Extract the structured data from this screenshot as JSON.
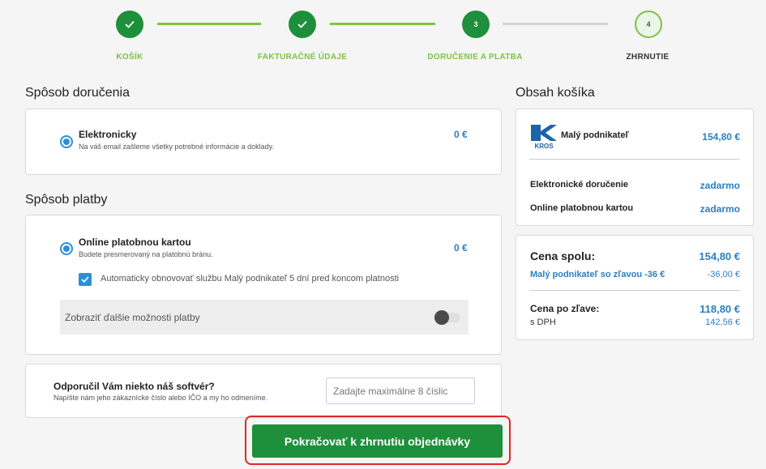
{
  "steps": [
    {
      "label": "KOŠÍK",
      "icon": "check-icon",
      "state": "done"
    },
    {
      "label": "FAKTURAČNÉ ÚDAJE",
      "icon": "check-icon",
      "state": "done"
    },
    {
      "label": "DORUČENIE A PLATBA",
      "number": "3",
      "state": "done"
    },
    {
      "label": "ZHRNUTIE",
      "number": "4",
      "state": "todo"
    }
  ],
  "delivery": {
    "title": "Spôsob doručenia",
    "option_title": "Elektronicky",
    "option_sub": "Na váš email zašleme všetky potrebné informácie a doklady.",
    "price": "0 €"
  },
  "payment": {
    "title": "Spôsob platby",
    "option_title": "Online platobnou kartou",
    "option_sub": "Budete presmerovaný na platobnú bránu.",
    "price": "0 €",
    "auto_renew_label": "Automaticky obnovovať službu Malý podnikateľ 5 dní pred koncom platnosti",
    "more_options_label": "Zobraziť ďalšie možnosti platby"
  },
  "referral": {
    "title": "Odporučil Vám niekto náš softvér?",
    "sub": "Napíšte nám jeho zákaznícke číslo alebo IČO a my ho odmeníme.",
    "placeholder": "Zadajte maximálne 8 číslic"
  },
  "cta_label": "Pokračovať k zhrnutiu objednávky",
  "cart": {
    "title": "Obsah košíka",
    "logo_text": "KROS",
    "product_name": "Malý podnikateľ",
    "product_price": "154,80 €",
    "delivery_label": "Elektronické doručenie",
    "delivery_value": "zadarmo",
    "payment_label": "Online platobnou kartou",
    "payment_value": "zadarmo"
  },
  "totals": {
    "total_label": "Cena spolu:",
    "total_value": "154,80 €",
    "discount_label": "Malý podnikateľ so zľavou -36 €",
    "discount_value": "-36,00 €",
    "after_label": "Cena po zľave:",
    "after_value": "118,80 €",
    "vat_label": "s DPH",
    "vat_value": "142,56 €"
  },
  "colors": {
    "accent_green": "#1e8f3a",
    "step_green": "#7dc242",
    "link_blue": "#2b7fc0",
    "highlight_red": "#e02424"
  }
}
